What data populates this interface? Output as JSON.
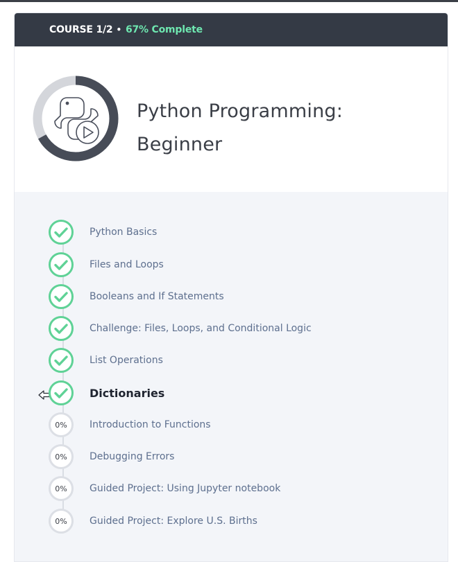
{
  "header": {
    "course_count": "COURSE 1/2",
    "bullet": "•",
    "complete": "67% Complete"
  },
  "course": {
    "title": "Python Programming: Beginner",
    "progress_fraction": 0.67,
    "icon": "python-play-icon"
  },
  "colors": {
    "header_bg": "#343a45",
    "complete_text": "#6ee7b0",
    "done_ring": "#5fd296",
    "todo_ring": "#dcdfe5",
    "progress_ring": "#474c57"
  },
  "lessons": [
    {
      "name": "Python Basics",
      "status": "done"
    },
    {
      "name": "Files and Loops",
      "status": "done"
    },
    {
      "name": "Booleans and If Statements",
      "status": "done"
    },
    {
      "name": "Challenge: Files, Loops, and Conditional Logic",
      "status": "done"
    },
    {
      "name": "List Operations",
      "status": "done"
    },
    {
      "name": "Dictionaries",
      "status": "done",
      "current": true
    },
    {
      "name": "Introduction to Functions",
      "status": "todo",
      "progress": "0%"
    },
    {
      "name": "Debugging Errors",
      "status": "todo",
      "progress": "0%"
    },
    {
      "name": "Guided Project: Using Jupyter notebook",
      "status": "todo",
      "progress": "0%"
    },
    {
      "name": "Guided Project: Explore U.S. Births",
      "status": "todo",
      "progress": "0%"
    }
  ]
}
